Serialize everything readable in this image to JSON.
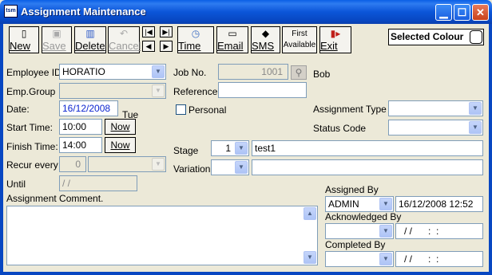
{
  "window": {
    "title": "Assignment Maintenance",
    "app_icon_text": "tsm",
    "minimize_icon": "minimize-icon",
    "maximize_icon": "maximize-icon",
    "close_icon": "close-icon"
  },
  "toolbar": {
    "new_label": "New",
    "save_label": "Save",
    "delete_label": "Delete",
    "cancel_label": "Cancel",
    "time_label": "Time",
    "email_label": "Email",
    "sms_label": "SMS",
    "first_available_line1": "First",
    "first_available_line2": "Available",
    "exit_label": "Exit",
    "selected_colour_label": "Selected Colour"
  },
  "form": {
    "employee_id_label": "Employee ID:",
    "employee_id_value": "HORATIO",
    "emp_group_label": "Emp.Group",
    "emp_group_value": "",
    "date_label": "Date:",
    "date_value": "16/12/2008",
    "day_value": "Tue",
    "start_time_label": "Start Time:",
    "start_time_value": "10:00",
    "finish_time_label": "Finish Time:",
    "finish_time_value": "14:00",
    "now_label": "Now",
    "recur_every_label": "Recur every",
    "recur_every_value": "0",
    "until_label": "Until",
    "until_value": "/ /",
    "job_no_label": "Job No.",
    "job_no_value": "1001",
    "job_owner": "Bob",
    "reference_label": "Reference",
    "reference_value": "",
    "personal_label": "Personal",
    "assignment_type_label": "Assignment Type",
    "status_code_label": "Status Code",
    "stage_label": "Stage",
    "stage_value": "1",
    "stage_text": "test1",
    "variation_label": "Variation",
    "variation_text": "",
    "assignment_comment_label": "Assignment Comment.",
    "assigned_by_label": "Assigned By",
    "assigned_by_value": "ADMIN",
    "assigned_by_datetime": "16/12/2008 12:52",
    "acknowledged_by_label": "Acknowledged By",
    "acknowledged_by_datetime": "/ /      :  :",
    "completed_by_label": "Completed By",
    "completed_by_datetime": "/ /      :  :"
  }
}
